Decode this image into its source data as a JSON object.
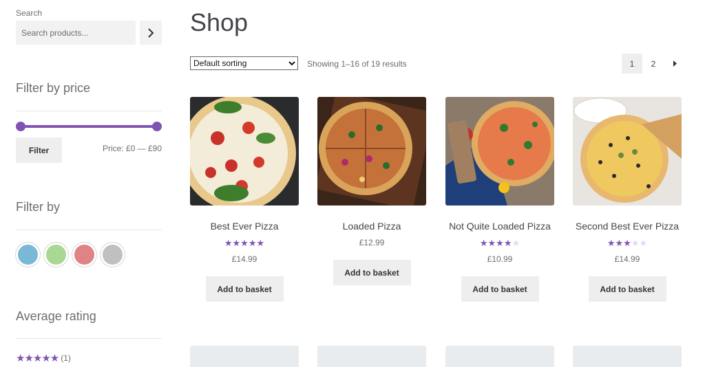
{
  "sidebar": {
    "search": {
      "label": "Search",
      "placeholder": "Search products..."
    },
    "filter_price": {
      "title": "Filter by price",
      "button": "Filter",
      "range": "Price: £0 — £90"
    },
    "filter_by": {
      "title": "Filter by",
      "swatches": [
        "#7ab8d8",
        "#a8d893",
        "#e08384",
        "#c0c0c0"
      ]
    },
    "average_rating": {
      "title": "Average rating",
      "stars": "★★★★★",
      "count": "(1)"
    }
  },
  "main": {
    "title": "Shop",
    "sorting": {
      "selected": "Default sorting"
    },
    "result_count": "Showing 1–16 of 19 results",
    "pagination": {
      "pages": [
        "1",
        "2"
      ],
      "next": "►"
    },
    "products": [
      {
        "name": "Best Ever Pizza",
        "rating": 5,
        "price": "£14.99",
        "button": "Add to basket"
      },
      {
        "name": "Loaded Pizza",
        "rating": 0,
        "price": "£12.99",
        "button": "Add to basket"
      },
      {
        "name": "Not Quite Loaded Pizza",
        "rating": 4,
        "price": "£10.99",
        "button": "Add to basket"
      },
      {
        "name": "Second Best Ever Pizza",
        "rating": 3,
        "price": "£14.99",
        "button": "Add to basket"
      }
    ]
  },
  "colors": {
    "accent": "#7f54b3",
    "button_bg": "#eeeeee"
  }
}
